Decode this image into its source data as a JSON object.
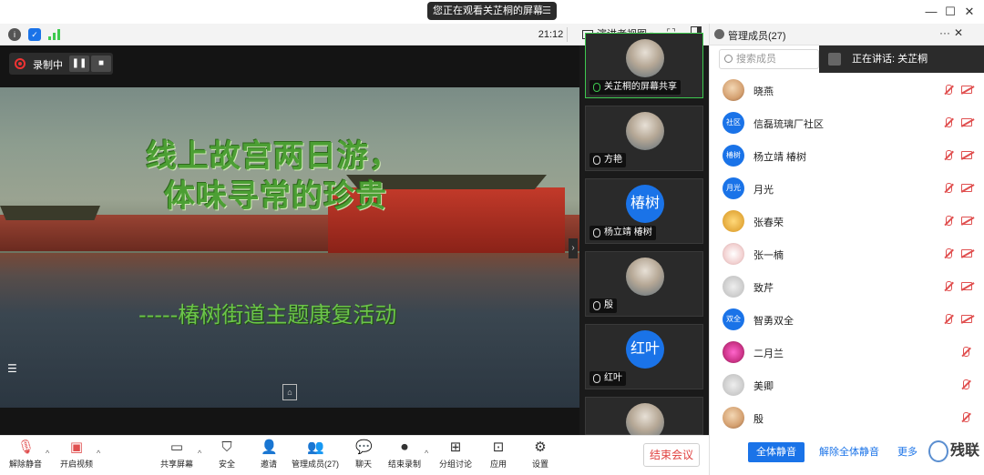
{
  "titlebar": {
    "share_notice": "您正在观看关芷桐的屏幕",
    "share_menu": "☰",
    "minimize": "—",
    "maximize": "☐",
    "close": "✕"
  },
  "toolbar": {
    "clock": "21:12",
    "view_label": "演讲者视图",
    "view_caret": "▾",
    "fullscreen": "⛶",
    "sidebar_toggle": "▯",
    "info_icon": "i",
    "security_icon": "✓"
  },
  "stage": {
    "recording_label": "录制中",
    "pause_icon": "❚❚",
    "stop_icon": "■",
    "slide_title_line1": "线上故宫两日游，",
    "slide_title_line2": "体味寻常的珍贵",
    "slide_subtitle": "-----椿树街道主题康复活动",
    "slide_menu_icon": "☰",
    "slide_logo": "⌂",
    "arrow": "›"
  },
  "video_tiles": [
    {
      "name": "关芷桐的屏幕共享",
      "avatar": "",
      "photo": true
    },
    {
      "name": "方艳",
      "avatar": "",
      "photo": true
    },
    {
      "name": "杨立靖 椿树",
      "avatar": "椿树",
      "photo": false
    },
    {
      "name": "殷",
      "avatar": "",
      "photo": true
    },
    {
      "name": "红叶",
      "avatar": "红叶",
      "photo": false
    },
    {
      "name": "",
      "avatar": "",
      "photo": true
    }
  ],
  "bottombar": {
    "mute_label": "解除静音",
    "video_label": "开启视频",
    "share_label": "共享屏幕",
    "security_label": "安全",
    "invite_label": "邀请",
    "members_label": "管理成员(27)",
    "chat_label": "聊天",
    "record_label": "结束录制",
    "breakout_label": "分组讨论",
    "apps_label": "应用",
    "settings_label": "设置",
    "end_label": "结束会议",
    "caret": "^"
  },
  "panel": {
    "title": "管理成员(27)",
    "more": "···",
    "close": "✕",
    "search_placeholder": "搜索成员",
    "speaking": "正在讲话: 关芷桐",
    "mute_all": "全体静音",
    "unmute_all": "解除全体静音",
    "more_link": "更多",
    "watermark": "残联"
  },
  "members": [
    {
      "name": "晓燕",
      "avatar": "",
      "style": "photo",
      "cam": true
    },
    {
      "name": "信磊琉璃厂社区",
      "avatar": "社区",
      "style": "blue",
      "cam": true
    },
    {
      "name": "杨立靖 椿树",
      "avatar": "椿树",
      "style": "blue",
      "cam": true
    },
    {
      "name": "月光",
      "avatar": "月光",
      "style": "blue",
      "cam": true
    },
    {
      "name": "张春荣",
      "avatar": "",
      "style": "egg",
      "cam": true
    },
    {
      "name": "张一楠",
      "avatar": "",
      "style": "cat",
      "cam": true
    },
    {
      "name": "致芹",
      "avatar": "",
      "style": "doc",
      "cam": true
    },
    {
      "name": "智勇双全",
      "avatar": "双全",
      "style": "blue",
      "cam": true
    },
    {
      "name": "二月兰",
      "avatar": "",
      "style": "flower",
      "cam": false
    },
    {
      "name": "美卿",
      "avatar": "",
      "style": "doc",
      "cam": false
    },
    {
      "name": "殷",
      "avatar": "",
      "style": "photo",
      "cam": false
    }
  ]
}
